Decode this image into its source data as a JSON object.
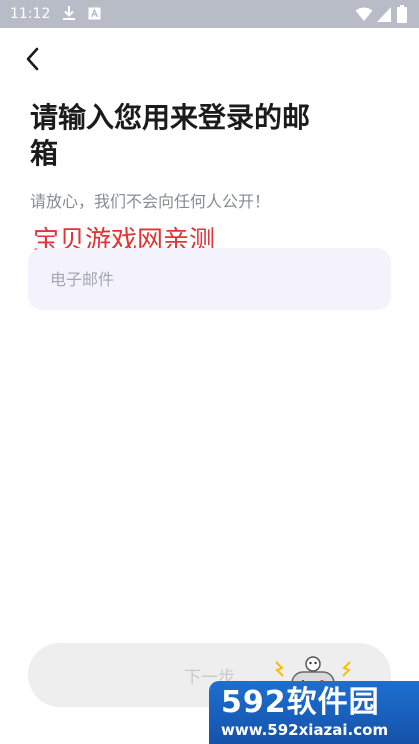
{
  "status_bar": {
    "time": "11:12",
    "icons": [
      "download-icon",
      "a-box-icon",
      "wifi-icon",
      "signal-icon",
      "battery-icon"
    ]
  },
  "header": {
    "back_icon": "chevron-left-icon"
  },
  "main": {
    "title": "请输入您用来登录的邮箱",
    "subtitle": "请放心，我们不会向任何人公开！",
    "watermark_text": "宝贝游戏网亲测",
    "email_field": {
      "value": "",
      "placeholder": "电子邮件"
    }
  },
  "footer": {
    "next_label": "下一步",
    "gamepad_icon": "gamepad-icon"
  },
  "brand_logo": {
    "main_text": "592软件园",
    "url_text": "www.592xiazai.com"
  },
  "colors": {
    "status_bar": "#b7bcc7",
    "input_background": "#f4f3fc",
    "button_background": "#eeeeee",
    "watermark_red": "#e03436",
    "brand_blue": "#1e6fd0"
  }
}
